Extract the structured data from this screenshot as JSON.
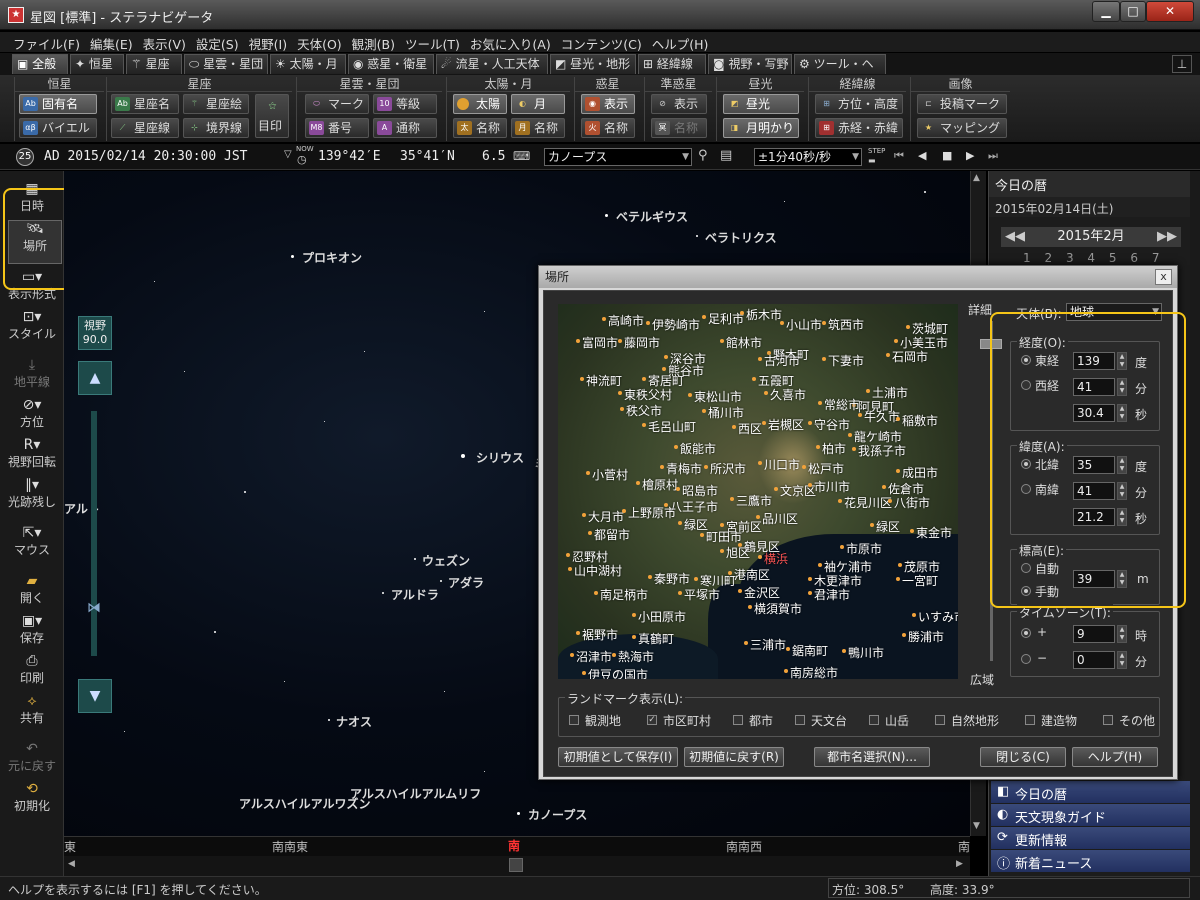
{
  "window": {
    "title": "星図 [標準] - ステラナビゲータ",
    "minimize": "▁",
    "maximize": "□",
    "close": "✕"
  },
  "menu": [
    "ファイル(F)",
    "編集(E)",
    "表示(V)",
    "設定(S)",
    "視野(I)",
    "天体(O)",
    "観測(B)",
    "ツール(T)",
    "お気に入り(A)",
    "コンテンツ(C)",
    "ヘルプ(H)"
  ],
  "tabs": [
    "全般",
    "恒星",
    "星座",
    "星雲・星団",
    "太陽・月",
    "惑星・衛星",
    "流星・人工天体",
    "昼光・地形",
    "経緯線",
    "視野・写野",
    "ツール・ヘルプ"
  ],
  "pin": "⊥",
  "ribbon": {
    "groups": [
      "恒星",
      "星座",
      "星雲・星団",
      "太陽・月",
      "惑星",
      "準惑星",
      "昼光",
      "経緯線",
      "画像"
    ],
    "star_names": "固有名",
    "bayer": "バイエル",
    "const_name": "星座名",
    "const_pic": "星座絵",
    "const_line": "星座線",
    "const_border": "境界線",
    "mejirushi": "目印",
    "mark": "マーク",
    "magnitude": "等級",
    "number": "番号",
    "common": "通称",
    "sun": "太陽",
    "moon": "月",
    "sun_name": "名称",
    "moon_name": "名称",
    "planet_show": "表示",
    "planet_name": "名称",
    "dwarf_show": "表示",
    "dwarf_name": "名称",
    "daylight": "昼光",
    "moonlight": "月明かり",
    "azalt": "方位・高度",
    "radec": "赤経・赤緯",
    "projmark": "投稿マーク",
    "mapping": "マッピング"
  },
  "status": {
    "day": "25",
    "datetime": "AD 2015/02/14 20:30:00 JST",
    "now": "NOW",
    "lon": "139°42′E",
    "lat": "35°41′N",
    "mag": "6.5",
    "target": "カノープス",
    "step": "±1分40秒/秒",
    "step_label": "STEP"
  },
  "left_tools": [
    "日時",
    "場所",
    "表示形式",
    "スタイル",
    "地平線",
    "方位",
    "視野回転",
    "光跡残し",
    "マウス",
    "開く",
    "保存",
    "印刷",
    "共有",
    "元に戻す",
    "初期化"
  ],
  "fov": {
    "label": "視野",
    "value": "90.0"
  },
  "stars": [
    "ベテルギウス",
    "ベラトリクス",
    "プロキオン",
    "シリウス",
    "ウェズン",
    "アダラ",
    "アルドラ",
    "ナオス",
    "アルスハイルアルムリフ",
    "アルスハイルアルワズン",
    "カノープス",
    "アルト"
  ],
  "compass": [
    "東",
    "南南東",
    "南",
    "南南西",
    "南"
  ],
  "statusbar": {
    "help": "ヘルプを表示するには [F1] を押してください。",
    "azimuth": "方位: 308.5°",
    "altitude": "高度: 33.9°"
  },
  "right": {
    "title": "今日の暦",
    "date": "2015年02月14日(土)",
    "month": "2015年2月",
    "days": [
      "1",
      "2",
      "3",
      "4",
      "5",
      "6",
      "7"
    ],
    "items": [
      "今日の暦",
      "天文現象ガイド",
      "更新情報",
      "新着ニュース"
    ]
  },
  "dialog": {
    "title": "場所",
    "close": "x",
    "detail": "詳細",
    "wide": "広域",
    "body_label": "天体(B):",
    "body_value": "地球",
    "lon_label": "経度(O):",
    "east": "東経",
    "west": "西経",
    "lon_deg": "139",
    "lon_min": "41",
    "lon_sec": "30.4",
    "lat_label": "緯度(A):",
    "north": "北緯",
    "south": "南緯",
    "lat_deg": "35",
    "lat_min": "41",
    "lat_sec": "21.2",
    "unit_deg": "度",
    "unit_min": "分",
    "unit_sec": "秒",
    "elev_label": "標高(E):",
    "auto": "自動",
    "manual": "手動",
    "elev": "39",
    "unit_m": "m",
    "tz_label": "タイムゾーン(T):",
    "plus": "+",
    "minus": "−",
    "tz_h": "9",
    "tz_m": "0",
    "unit_h": "時",
    "unit_mm": "分",
    "landmark_label": "ランドマーク表示(L):",
    "landmarks": [
      {
        "label": "観測地",
        "checked": false
      },
      {
        "label": "市区町村",
        "checked": true
      },
      {
        "label": "都市",
        "checked": false
      },
      {
        "label": "天文台",
        "checked": false
      },
      {
        "label": "山岳",
        "checked": false
      },
      {
        "label": "自然地形",
        "checked": false
      },
      {
        "label": "建造物",
        "checked": false
      },
      {
        "label": "その他",
        "checked": false
      }
    ],
    "save_default": "初期値として保存(I)",
    "restore_default": "初期値に戻す(R)",
    "city_select": "都市名選択(N)...",
    "close_btn": "閉じる(C)",
    "help_btn": "ヘルプ(H)",
    "towns": [
      "高崎市",
      "伊勢崎市",
      "足利市",
      "栃木市",
      "小山市",
      "筑西市",
      "富岡市",
      "藤岡市",
      "館林市",
      "野木町",
      "茨城町",
      "小美玉市",
      "深谷市",
      "古河市",
      "下妻市",
      "石岡市",
      "神流町",
      "寄居町",
      "熊谷市",
      "五霞町",
      "東秩父村",
      "東松山市",
      "久喜市",
      "土浦市",
      "阿見町",
      "秩父市",
      "桶川市",
      "常総市",
      "牛久市",
      "稲敷市",
      "毛呂山町",
      "西区",
      "岩槻区",
      "守谷市",
      "龍ケ崎市",
      "飯能市",
      "柏市",
      "我孫子市",
      "小菅村",
      "青梅市",
      "所沢市",
      "川口市",
      "松戸市",
      "成田市",
      "檜原村",
      "昭島市",
      "文京区",
      "市川市",
      "佐倉市",
      "八王子市",
      "三鷹市",
      "花見川区",
      "八街市",
      "大月市",
      "上野原市",
      "緑区",
      "品川区",
      "宮前区",
      "緑区",
      "東金市",
      "都留市",
      "町田市",
      "鶴見区",
      "市原市",
      "忍野村",
      "山中湖村",
      "旭区",
      "横浜",
      "袖ケ浦市",
      "茂原市",
      "秦野市",
      "寒川町",
      "港南区",
      "木更津市",
      "一宮町",
      "南足柄市",
      "平塚市",
      "金沢区",
      "君津市",
      "小田原市",
      "横須賀市",
      "いすみ市",
      "裾野市",
      "真鶴町",
      "勝浦市",
      "三浦市",
      "沼津市",
      "熱海市",
      "鋸南町",
      "鴨川市",
      "伊豆の国市",
      "南房総市"
    ]
  }
}
